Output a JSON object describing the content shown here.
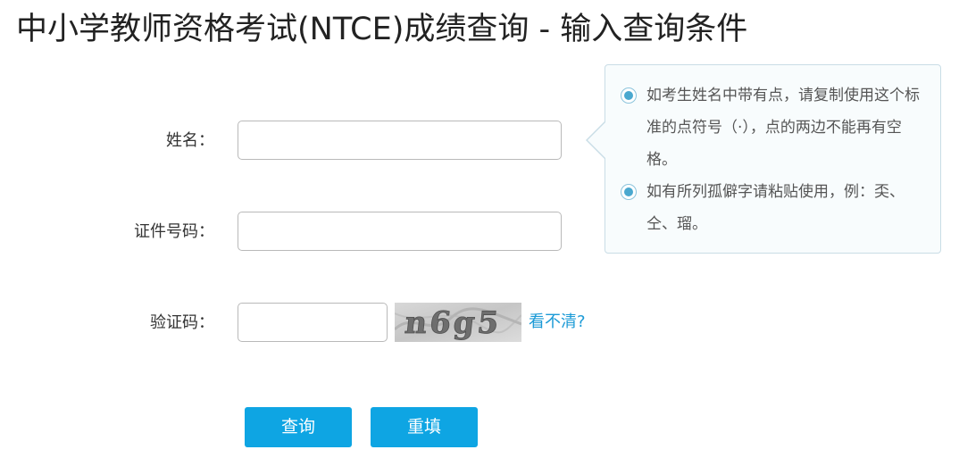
{
  "page": {
    "title": "中小学教师资格考试(NTCE)成绩查询 - 输入查询条件"
  },
  "form": {
    "name_label": "姓名：",
    "name_value": "",
    "id_label": "证件号码：",
    "id_value": "",
    "captcha_label": "验证码：",
    "captcha_value": "",
    "captcha_text": "n6g5",
    "captcha_refresh": "看不清?"
  },
  "buttons": {
    "query": "查询",
    "reset": "重填"
  },
  "tips": {
    "items": [
      "如考生姓名中带有点，请复制使用这个标准的点符号（·），点的两边不能再有空格。",
      "如有所列孤僻字请粘贴使用，例：奀、仝、瑠。"
    ]
  },
  "colors": {
    "button_bg": "#0ea5e3",
    "link": "#1b9ad6",
    "tip_bullet": "#4aa8cf"
  }
}
